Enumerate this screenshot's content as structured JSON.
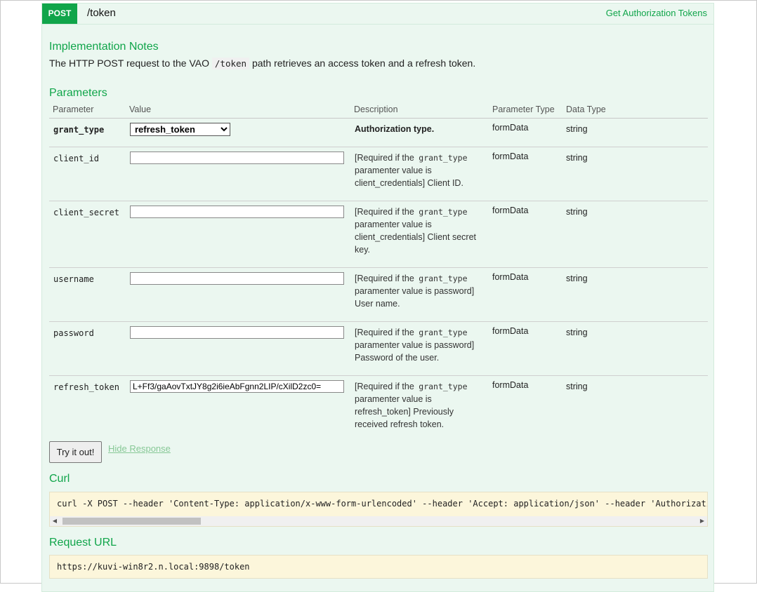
{
  "operation": {
    "method": "POST",
    "path": "/token",
    "summary": "Get Authorization Tokens"
  },
  "notes": {
    "heading": "Implementation Notes",
    "text_before": "The HTTP POST request to the VAO",
    "code": "/token",
    "text_after": "path retrieves an access token and a refresh token."
  },
  "parameters": {
    "heading": "Parameters",
    "columns": [
      "Parameter",
      "Value",
      "Description",
      "Parameter Type",
      "Data Type"
    ],
    "rows": [
      {
        "name": "grant_type",
        "value": "refresh_token",
        "description": "Authorization type.",
        "param_type": "formData",
        "data_type": "string"
      },
      {
        "name": "client_id",
        "value": "",
        "desc_prefix": "[Required if the",
        "desc_code": "grant_type",
        "desc_suffix": "paramenter value is client_credentials] Client ID.",
        "param_type": "formData",
        "data_type": "string"
      },
      {
        "name": "client_secret",
        "value": "",
        "desc_prefix": "[Required if the",
        "desc_code": "grant_type",
        "desc_suffix": "paramenter value is client_credentials] Client secret key.",
        "param_type": "formData",
        "data_type": "string"
      },
      {
        "name": "username",
        "value": "",
        "desc_prefix": "[Required if the",
        "desc_code": "grant_type",
        "desc_suffix": "paramenter value is password] User name.",
        "param_type": "formData",
        "data_type": "string"
      },
      {
        "name": "password",
        "value": "",
        "desc_prefix": "[Required if the",
        "desc_code": "grant_type",
        "desc_suffix": "paramenter value is password] Password of the user.",
        "param_type": "formData",
        "data_type": "string"
      },
      {
        "name": "refresh_token",
        "value": "L+Ff3/gaAovTxtJY8g2i6ieAbFgnn2LIP/cXilD2zc0=",
        "desc_prefix": "[Required if the",
        "desc_code": "grant_type",
        "desc_suffix": "paramenter value is refresh_token] Previously received refresh token.",
        "param_type": "formData",
        "data_type": "string"
      }
    ]
  },
  "actions": {
    "try_label": "Try it out!",
    "hide_label": "Hide Response"
  },
  "curl": {
    "heading": "Curl",
    "command": "curl -X POST --header 'Content-Type: application/x-www-form-urlencoded' --header 'Accept: application/json' --header 'Authorization: Basic'"
  },
  "request_url": {
    "heading": "Request URL",
    "url": "https://kuvi-win8r2.n.local:9898/token"
  },
  "colors": {
    "accent_green": "#10a54a",
    "panel_bg": "#ebf7f0",
    "code_box_bg": "#fcf6db"
  }
}
